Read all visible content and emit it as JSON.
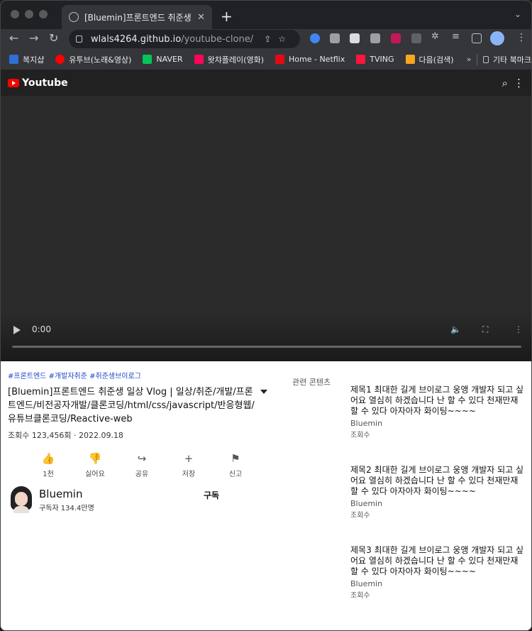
{
  "browser": {
    "tab_title": "[Bluemin]프론트엔드 취준생 일상 V",
    "new_tab": "+",
    "address_host": "wlals4264.github.io",
    "address_path": "/youtube-clone/",
    "bookmarks": [
      {
        "label": "복지샵",
        "color": "#2f6fd6"
      },
      {
        "label": "유투브(노래&영상)",
        "color": "#ff0000"
      },
      {
        "label": "NAVER",
        "color": "#03c75a"
      },
      {
        "label": "왓챠플레이(영화)",
        "color": "#ff0558"
      },
      {
        "label": "Home - Netflix",
        "color": "#e50914"
      },
      {
        "label": "TVING",
        "color": "#ff153c"
      },
      {
        "label": "다음(검색)",
        "color": "#f5a623"
      }
    ],
    "bookmarks_more": "»",
    "other_bookmarks": "기타 북마크"
  },
  "header": {
    "title": "Youtube"
  },
  "player": {
    "time": "0:00"
  },
  "video": {
    "tags": "#프론트엔드 #개발자취준 #취준생브이로그",
    "title": "[Bluemin]프론트엔드 취준생 일상 Vlog | 일상/취준/개발/프론트엔드/비전공자개발/클론코딩/html/css/javascript/반응형웹/유튜브클론코딩/Reactive-web",
    "meta": "조회수 123,456회 · 2022.09.18",
    "actions": [
      {
        "icon": "👍",
        "label": "1천"
      },
      {
        "icon": "👎",
        "label": "싫어요"
      },
      {
        "icon": "↪",
        "label": "공유"
      },
      {
        "icon": "+",
        "label": "저장"
      },
      {
        "icon": "⚑",
        "label": "신고"
      }
    ]
  },
  "channel": {
    "name": "Bluemin",
    "subscribers": "구독자 134.4만명",
    "subscribe_label": "구독"
  },
  "related": {
    "label": "관련 콘텐츠",
    "items": [
      {
        "title": "제목1 최대한 길게 브이로그 웅앵 개발자 되고 싶어요 열심히 하겠습니다 난 할 수 있다 천재만재 할 수 있다 아자아자 화이팅~~~~",
        "channel": "Bluemin",
        "views": "조회수"
      },
      {
        "title": "제목2 최대한 길게 브이로그 웅앵 개발자 되고 싶어요 열심히 하겠습니다 난 할 수 있다 천재만재 할 수 있다 아자아자 화이팅~~~~",
        "channel": "Bluemin",
        "views": "조회수"
      },
      {
        "title": "제목3 최대한 길게 브이로그 웅앵 개발자 되고 싶어요 열심히 하겠습니다 난 할 수 있다 천재만재 할 수 있다 아자아자 화이팅~~~~",
        "channel": "Bluemin",
        "views": "조회수"
      }
    ]
  }
}
